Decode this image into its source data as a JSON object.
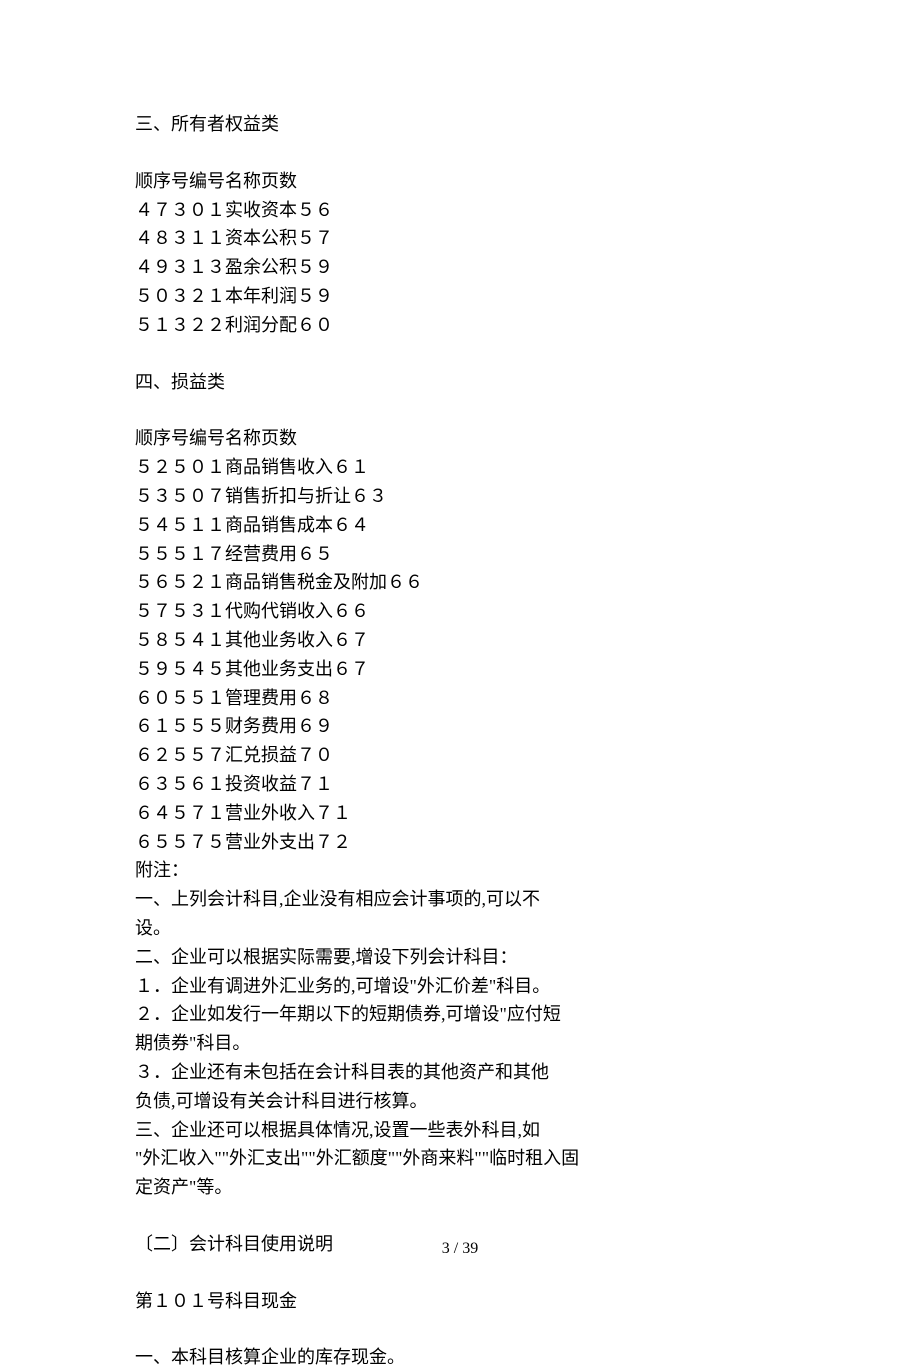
{
  "sections": [
    {
      "heading": "三、所有者权益类",
      "header": "顺序号编号名称页数",
      "rows": [
        "４７３０１实收资本５６",
        "４８３１１资本公积５７",
        "４９３１３盈余公积５９",
        "５０３２１本年利润５９",
        "５１３２２利润分配６０"
      ]
    },
    {
      "heading": "四、损益类",
      "header": "顺序号编号名称页数",
      "rows": [
        "５２５０１商品销售收入６１",
        "５３５０７销售折扣与折让６３",
        "５４５１１商品销售成本６４",
        "５５５１７经营费用６５",
        "５６５２１商品销售税金及附加６６",
        "５７５３１代购代销收入６６",
        "５８５４１其他业务收入６７",
        "５９５４５其他业务支出６７",
        "６０５５１管理费用６８",
        "６１５５５财务费用６９",
        "６２５５７汇兑损益７０",
        "６３５６１投资收益７１",
        "６４５７１营业外收入７１",
        "６５５７５营业外支出７２"
      ]
    }
  ],
  "appendix": {
    "label": "附注：",
    "lines": [
      "一、上列会计科目,企业没有相应会计事项的,可以不",
      "设。",
      "二、企业可以根据实际需要,增设下列会计科目：",
      "１．企业有调进外汇业务的,可增设\"外汇价差\"科目。",
      "２．企业如发行一年期以下的短期债券,可增设\"应付短",
      "期债券\"科目。",
      "３．企业还有未包括在会计科目表的其他资产和其他",
      "负债,可增设有关会计科目进行核算。",
      "三、企业还可以根据具体情况,设置一些表外科目,如",
      "\"外汇收入\"\"外汇支出\"\"外汇额度\"\"外商来料\"\"临时租入固",
      "定资产\"等。"
    ]
  },
  "section2": {
    "heading": "〔二〕会计科目使用说明",
    "subject": "第１０１号科目现金",
    "line1": "一、本科目核算企业的库存现金。"
  },
  "footer": "3  /  39"
}
